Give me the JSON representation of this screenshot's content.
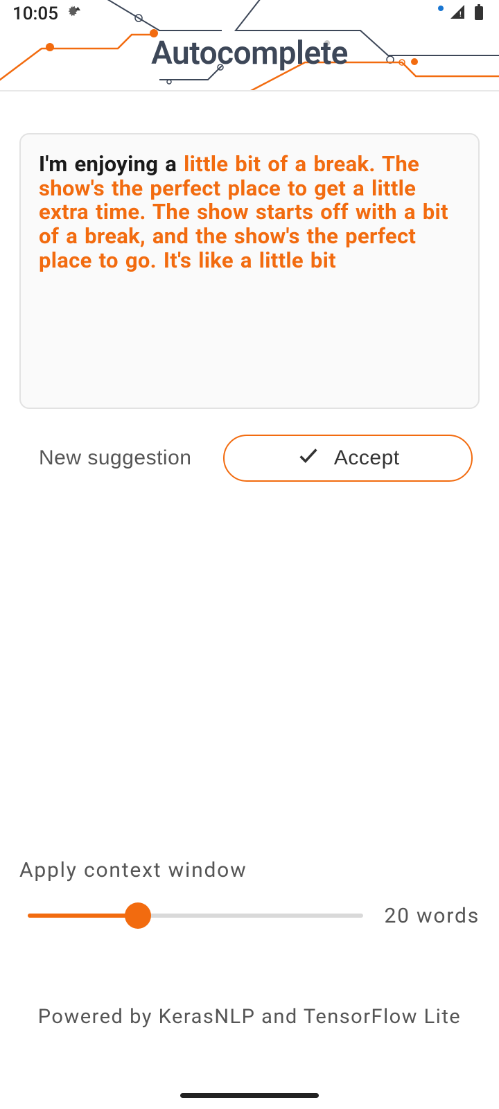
{
  "status": {
    "time": "10:05"
  },
  "header": {
    "title": "Autocomplete"
  },
  "text": {
    "prefix": "I'm enjoying a ",
    "suggestion": "little bit of a break. The show's the perfect place to get a little extra time. The show starts off with a bit of a break, and the show's the perfect place to go. It's like a little bit"
  },
  "buttons": {
    "new_suggestion": "New suggestion",
    "accept": "Accept"
  },
  "slider": {
    "label": "Apply context window",
    "value_text": "20 words",
    "value": 20
  },
  "footer": {
    "text": "Powered by KerasNLP and TensorFlow Lite"
  },
  "colors": {
    "accent": "#f26b0f"
  }
}
